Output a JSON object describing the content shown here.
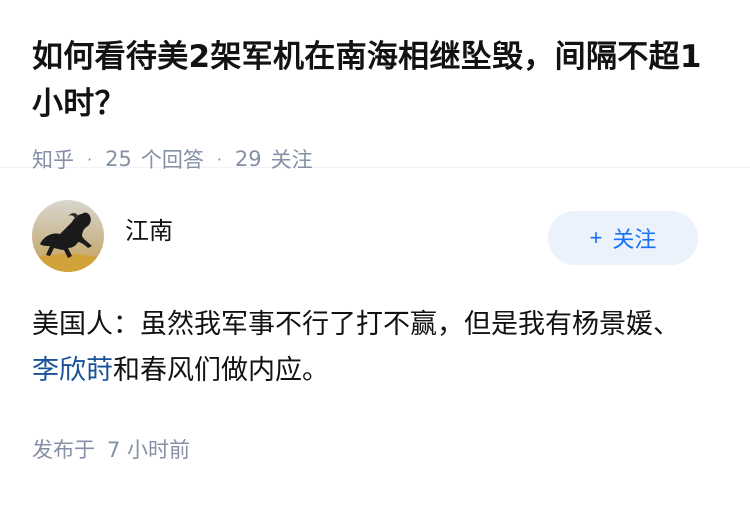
{
  "question": {
    "title": "如何看待美2架军机在南海相继坠毁，间隔不超1小时？",
    "source": "知乎",
    "answers_count": "25",
    "answers_label": "个回答",
    "followers_count": "29",
    "followers_label": "关注"
  },
  "answer": {
    "author": {
      "name": "江南",
      "avatar_icon": "horse-avatar"
    },
    "follow_button": {
      "plus": "+",
      "label": "关注"
    },
    "content": {
      "part1": "美国人：虽然我军事不行了打不赢，但是我有杨景媛、",
      "mention": "李欣莳",
      "part2": "和春风们做内应。"
    },
    "time": {
      "label": "发布于",
      "value": "7 小时前"
    }
  },
  "colors": {
    "text": "#121212",
    "meta": "#8590a6",
    "accent": "#1772f6",
    "button_bg": "#ebf2fc",
    "mention": "#175199"
  }
}
